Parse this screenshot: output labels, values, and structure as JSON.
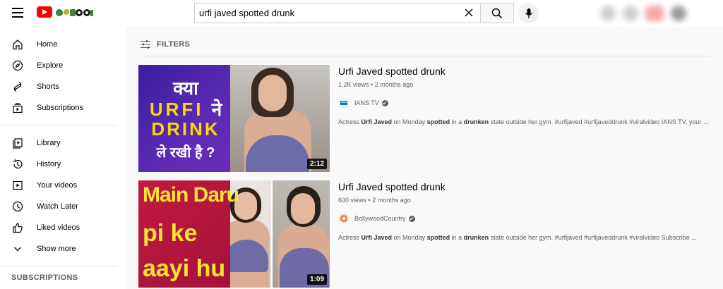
{
  "header": {
    "search_value": "urfi javed spotted drunk",
    "search_placeholder": "Search"
  },
  "sidebar": {
    "items": [
      {
        "label": "Home",
        "icon": "home-icon"
      },
      {
        "label": "Explore",
        "icon": "compass-icon"
      },
      {
        "label": "Shorts",
        "icon": "shorts-icon"
      },
      {
        "label": "Subscriptions",
        "icon": "subscriptions-icon"
      }
    ],
    "library_items": [
      {
        "label": "Library",
        "icon": "library-icon"
      },
      {
        "label": "History",
        "icon": "history-icon"
      },
      {
        "label": "Your videos",
        "icon": "your-videos-icon"
      },
      {
        "label": "Watch Later",
        "icon": "clock-icon"
      },
      {
        "label": "Liked videos",
        "icon": "thumbs-up-icon"
      },
      {
        "label": "Show more",
        "icon": "chevron-down-icon"
      }
    ],
    "subscriptions_heading": "SUBSCRIPTIONS"
  },
  "filters_label": "FILTERS",
  "results": [
    {
      "title": "Urfi Javed spotted drunk",
      "views": "1.2K views",
      "age": "2 months ago",
      "channel": "IANS TV",
      "verified": true,
      "description_parts": [
        {
          "t": "Actress ",
          "b": false
        },
        {
          "t": "Urfi Javed",
          "b": true
        },
        {
          "t": " on Monday ",
          "b": false
        },
        {
          "t": "spotted",
          "b": true
        },
        {
          "t": " in a ",
          "b": false
        },
        {
          "t": "drunken",
          "b": true
        },
        {
          "t": " state outside her gym. #urfijaved #urfijaveddrunk #viralvideo IANS TV, your go ...",
          "b": false
        }
      ],
      "duration": "2:12",
      "thumb_text": {
        "l1": "क्या",
        "l2a": "URFI",
        "l2b": "ने",
        "l3": "DRINK",
        "l4": "ले रखी है ?"
      }
    },
    {
      "title": "Urfi Javed spotted drunk",
      "views": "600 views",
      "age": "2 months ago",
      "channel": "BollywoodCountry",
      "verified": true,
      "description_parts": [
        {
          "t": "Actress ",
          "b": false
        },
        {
          "t": "Urfi Javed",
          "b": true
        },
        {
          "t": " on Monday ",
          "b": false
        },
        {
          "t": "spotted",
          "b": true
        },
        {
          "t": " in a ",
          "b": false
        },
        {
          "t": "drunken",
          "b": true
        },
        {
          "t": " state outside her gym. #urfijaved #urfijaveddrunk #viralvideo Subscribe ...",
          "b": false
        }
      ],
      "duration": "1:09",
      "thumb_text": {
        "l1": "Main Daru",
        "l2": "pi ke",
        "l3": "aayi hu"
      }
    }
  ],
  "colors": {
    "brand_red": "#ff0000",
    "text_primary": "#030303",
    "text_secondary": "#606060"
  }
}
